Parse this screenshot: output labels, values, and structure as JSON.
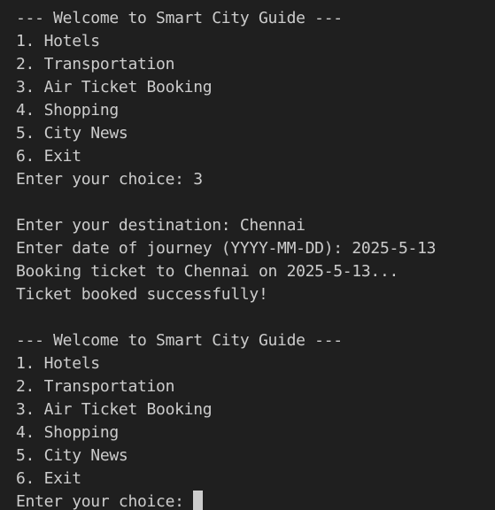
{
  "terminal": {
    "lines": [
      "--- Welcome to Smart City Guide ---",
      "1. Hotels",
      "2. Transportation",
      "3. Air Ticket Booking",
      "4. Shopping",
      "5. City News",
      "6. Exit",
      "Enter your choice: 3",
      "",
      "Enter your destination: Chennai",
      "Enter date of journey (YYYY-MM-DD): 2025-5-13",
      "Booking ticket to Chennai on 2025-5-13...",
      "Ticket booked successfully!",
      "",
      "--- Welcome to Smart City Guide ---",
      "1. Hotels",
      "2. Transportation",
      "3. Air Ticket Booking",
      "4. Shopping",
      "5. City News",
      "6. Exit"
    ],
    "prompt": "Enter your choice: ",
    "background_color": "#1f1f1f",
    "text_color": "#cccccc"
  }
}
